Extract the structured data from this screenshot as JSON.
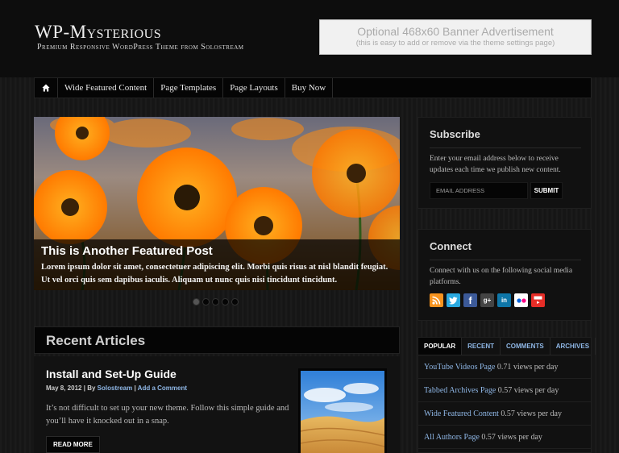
{
  "header": {
    "site_title": "WP-Mysterious",
    "tagline": "Premium Responsive WordPress Theme from Solostream",
    "banner_title": "Optional 468x60 Banner Advertisement",
    "banner_sub": "(this is easy to add or remove via the theme settings page)"
  },
  "nav": {
    "home_icon": "home-icon",
    "items": [
      "Wide Featured Content",
      "Page Templates",
      "Page Layouts",
      "Buy Now"
    ]
  },
  "featured": {
    "title": "This is Another Featured Post",
    "excerpt": "Lorem ipsum dolor sit amet, consectetuer adipiscing elit. Morbi quis risus at nisl blandit feugiat. Ut vel orci quis sem dapibus iaculis. Aliquam ut nunc quis nisi tincidunt tincidunt.",
    "slides_total": 5,
    "active_slide": 1
  },
  "recent": {
    "heading": "Recent Articles",
    "post": {
      "title": "Install and Set-Up Guide",
      "date": "May 8, 2012",
      "by": "By",
      "author": "Solostream",
      "sep": "|",
      "comment_link": "Add a Comment",
      "excerpt": "It’s not difficult to set up your new theme. Follow this simple guide and you’ll have it knocked out in a snap.",
      "read_more": "READ MORE"
    }
  },
  "subscribe": {
    "title": "Subscribe",
    "text": "Enter your email address below to receive updates each time we publish new content.",
    "placeholder": "EMAIL ADDRESS",
    "submit": "SUBMIT"
  },
  "connect": {
    "title": "Connect",
    "text": "Connect with us on the following social media platforms.",
    "icons": [
      "rss-icon",
      "twitter-icon",
      "facebook-icon",
      "google-plus-icon",
      "linkedin-icon",
      "flickr-icon",
      "youtube-icon"
    ]
  },
  "tabs": {
    "labels": [
      "POPULAR",
      "RECENT",
      "COMMENTS",
      "ARCHIVES"
    ],
    "items": [
      {
        "link": "YouTube Videos Page",
        "views": "0.71 views per day"
      },
      {
        "link": "Tabbed Archives Page",
        "views": "0.57 views per day"
      },
      {
        "link": "Wide Featured Content",
        "views": "0.57 views per day"
      },
      {
        "link": "All Authors Page",
        "views": "0.57 views per day"
      }
    ]
  },
  "colors": {
    "link": "#8fb7e6",
    "background": "#161616",
    "rss": "#f7931e",
    "twitter": "#2aa9e0",
    "facebook": "#3b5998",
    "google_plus": "#444444",
    "linkedin": "#0e76a8",
    "flickr": "#ffffff",
    "youtube": "#e52d27"
  }
}
